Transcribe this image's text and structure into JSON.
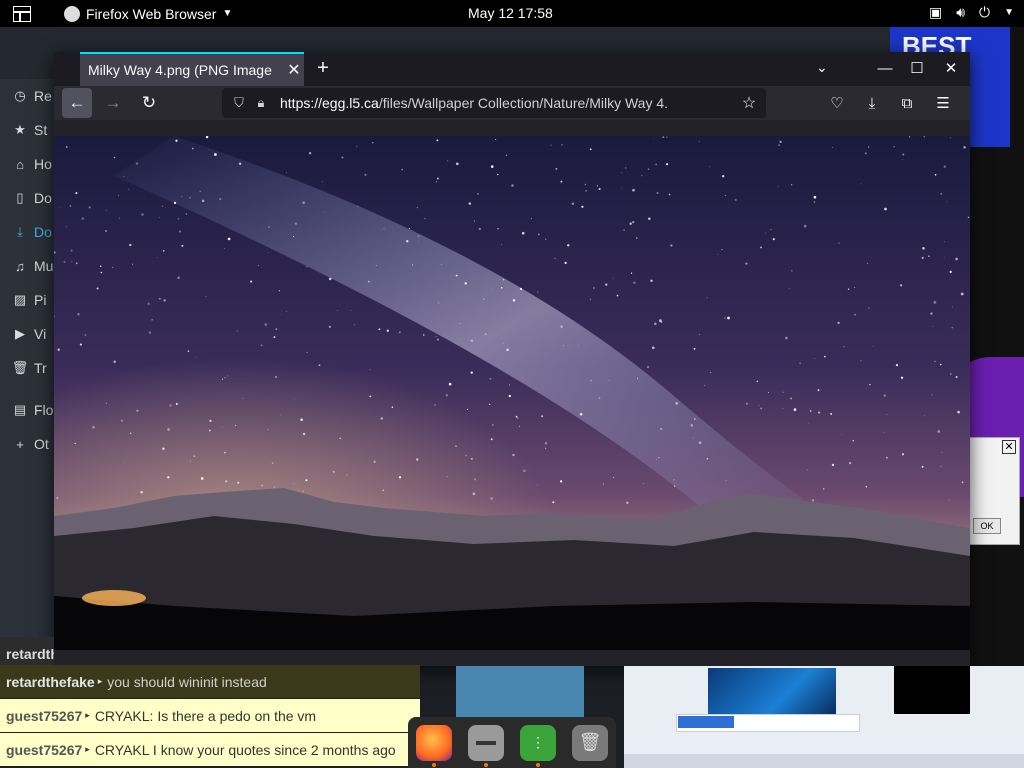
{
  "topbar": {
    "app_name": "Firefox Web Browser",
    "clock": "May 12  17:58"
  },
  "files_sidebar": {
    "items": [
      {
        "label": "Re",
        "icon": "clock-icon"
      },
      {
        "label": "St",
        "icon": "star-icon"
      },
      {
        "label": "Ho",
        "icon": "home-icon"
      },
      {
        "label": "Do",
        "icon": "document-icon"
      },
      {
        "label": "Do",
        "icon": "download-icon"
      },
      {
        "label": "Mu",
        "icon": "music-icon"
      },
      {
        "label": "Pi",
        "icon": "picture-icon"
      },
      {
        "label": "Vi",
        "icon": "video-icon"
      },
      {
        "label": "Tr",
        "icon": "trash-icon"
      },
      {
        "label": "Flo",
        "icon": "floppy-icon"
      },
      {
        "label": "Ot",
        "icon": "plus-icon"
      }
    ]
  },
  "background_right": {
    "logo_text": "BEST",
    "dialog_ok": "OK"
  },
  "firefox": {
    "tab_title": "Milky Way 4.png (PNG Image",
    "url_host": "https://egg.l5.ca",
    "url_path": "/files/Wallpaper Collection/Nature/Milky Way 4.",
    "accent": "#00ddff"
  },
  "chat": {
    "row1_user": "retardth",
    "row2_user": "retardthefake",
    "row2_msg": "you should wininit instead",
    "row3_user": "guest75267",
    "row3_msg": "CRYAKL: Is there a pedo on the vm",
    "row4_user": "guest75267",
    "row4_msg": "CRYAKL I know your quotes since 2 months ago"
  },
  "dock": [
    "firefox-icon",
    "files-icon",
    "archive-icon",
    "trash-icon"
  ]
}
